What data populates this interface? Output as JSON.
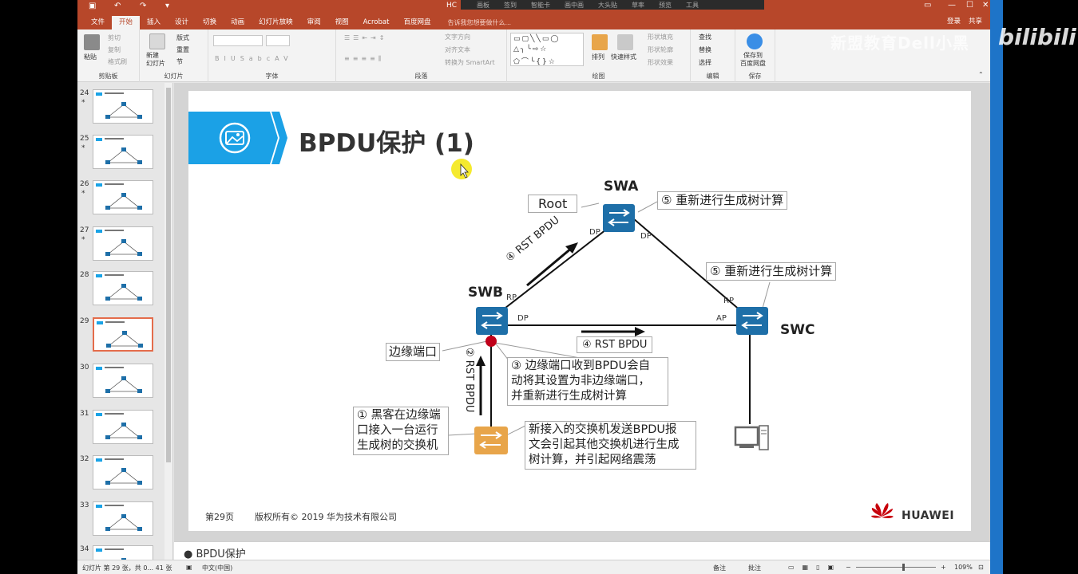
{
  "app": {
    "doc_title": "HC",
    "tabs": [
      "文件",
      "开始",
      "插入",
      "设计",
      "切换",
      "动画",
      "幻灯片放映",
      "审阅",
      "视图",
      "Acrobat",
      "百度网盘"
    ],
    "tell_me": "告诉我您想要做什么...",
    "login": "登录",
    "share": "共享"
  },
  "overlay_bar": [
    "画板",
    "签到",
    "智能卡",
    "画中画",
    "大头贴",
    "草率",
    "预览",
    "工具"
  ],
  "ribbon": {
    "clipboard": {
      "label": "剪贴板",
      "paste": "粘贴",
      "cut": "剪切",
      "copy": "复制",
      "format_painter": "格式刷"
    },
    "slides": {
      "label": "幻灯片",
      "new_slide": "新建\n幻灯片",
      "layout": "版式",
      "reset": "重置",
      "section": "节"
    },
    "font": {
      "label": "字体"
    },
    "paragraph": {
      "label": "段落",
      "text_direction": "文字方向",
      "align_text": "对齐文本",
      "smartart": "转换为 SmartArt"
    },
    "drawing": {
      "label": "绘图",
      "arrange": "排列",
      "quick_styles": "快速样式",
      "shape_fill": "形状填充",
      "shape_outline": "形状轮廓",
      "shape_effects": "形状效果"
    },
    "editing": {
      "label": "编辑",
      "find": "查找",
      "replace": "替换",
      "select": "选择"
    },
    "save": {
      "label": "保存",
      "save_to": "保存到\n百度网盘"
    }
  },
  "thumbnails": [
    {
      "num": "24",
      "star": "*"
    },
    {
      "num": "25",
      "star": "*"
    },
    {
      "num": "26",
      "star": "*"
    },
    {
      "num": "27",
      "star": "*"
    },
    {
      "num": "28",
      "star": ""
    },
    {
      "num": "29",
      "star": ""
    },
    {
      "num": "30",
      "star": ""
    },
    {
      "num": "31",
      "star": ""
    },
    {
      "num": "32",
      "star": ""
    },
    {
      "num": "33",
      "star": ""
    },
    {
      "num": "34",
      "star": ""
    }
  ],
  "selected_thumbnail": "29",
  "slide": {
    "title": "BPDU保护 (1)",
    "page": "第29页",
    "copyright": "版权所有© 2019 华为技术有限公司",
    "brand": "HUAWEI",
    "diagram": {
      "swa": "SWA",
      "swb": "SWB",
      "swc": "SWC",
      "root": "Root",
      "swa_note": "⑤ 重新进行生成树计算",
      "swc_note": "⑤ 重新进行生成树计算",
      "rst_bpdu_top": "④ RST BPDU",
      "rst_bpdu_mid": "④ RST BPDU",
      "rst_bpdu_vert": "② RST BPDU",
      "edge_port": "边缘端口",
      "step3": [
        "③ 边缘端口收到BPDU会自",
        "动将其设置为非边缘端口，",
        "并重新进行生成树计算"
      ],
      "step1": [
        "① 黑客在边缘端",
        "口接入一台运行",
        "生成树的交换机"
      ],
      "new_switch_note": [
        "新接入的交换机发送BPDU报",
        "文会引起其他交换机进行生成",
        "树计算，并引起网络震荡"
      ],
      "port_swa_left": "DP",
      "port_swa_right": "DP",
      "port_swb_up": "RP",
      "port_swb_right": "DP",
      "port_swc_up": "RP",
      "port_swc_left": "AP"
    }
  },
  "notes": "BPDU保护",
  "status": {
    "slide_info": "幻灯片 第 29 张，共 0... 41 张",
    "language": "中文(中国)",
    "notes_btn": "备注",
    "comments_btn": "批注",
    "zoom": "109%"
  },
  "watermark": {
    "left": "新盟教育Dell小黑",
    "right": "bilibili"
  },
  "colors": {
    "accent": "#b7472a",
    "banner": "#1ba1e6",
    "switch_blue": "#1e6fa8",
    "switch_orange": "#e8a54a",
    "port_dot": "#c0001a"
  }
}
